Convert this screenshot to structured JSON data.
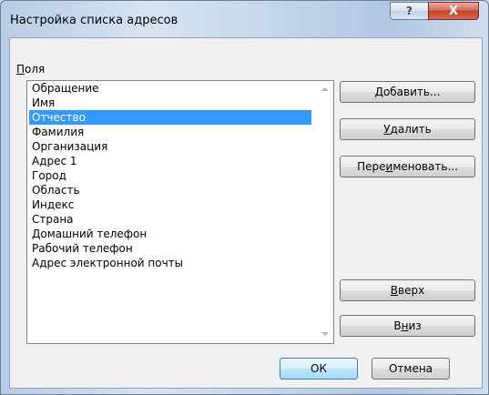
{
  "window": {
    "title": "Настройка списка адресов",
    "help_glyph": "?",
    "close_glyph": "X"
  },
  "fields": {
    "label_accel": "П",
    "label_rest": "оля",
    "items": [
      "Обращение",
      "Имя",
      "Отчество",
      "Фамилия",
      "Организация",
      "Адрес 1",
      "Город",
      "Область",
      "Индекс",
      "Страна",
      "Домашний телефон",
      "Рабочий телефон",
      "Адрес электронной почты"
    ],
    "selected_index": 2
  },
  "buttons": {
    "add": {
      "accel": "Д",
      "rest": "обавить..."
    },
    "delete": {
      "accel": "У",
      "rest": "далить"
    },
    "rename": {
      "pre": "Пере",
      "accel": "и",
      "rest": "меновать..."
    },
    "up": {
      "accel": "В",
      "rest": "верх"
    },
    "down": {
      "pre": "В",
      "accel": "н",
      "rest": "из"
    },
    "ok": "ОК",
    "cancel": "Отмена"
  },
  "colors": {
    "selection": "#3399ff",
    "close_button": "#c7432e"
  }
}
